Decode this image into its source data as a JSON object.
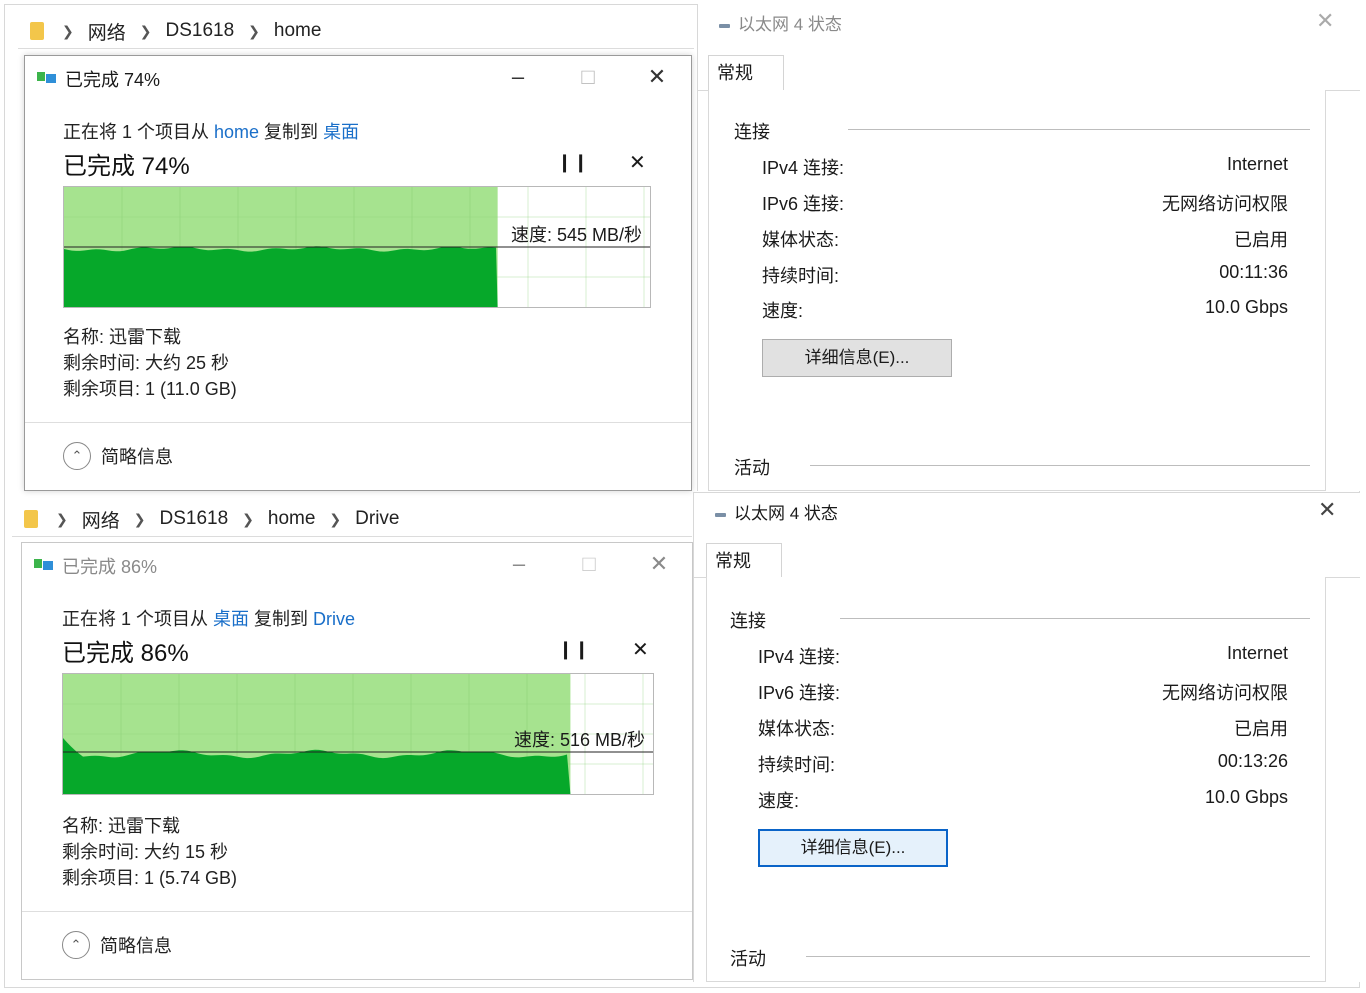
{
  "colors": {
    "link": "#1a6fc9",
    "graph_light": "#a6e38f",
    "graph_dark": "#06a82a",
    "focus": "#0a64c8"
  },
  "top": {
    "explorer": {
      "crumbs": [
        "网络",
        "DS1618",
        "home"
      ]
    },
    "copy": {
      "title": "已完成 74%",
      "from_prefix": "正在将 1 个项目从 ",
      "from": "home",
      "to_mid": " 复制到 ",
      "to": "桌面",
      "percent_text": "已完成 74%",
      "progress": 0.74,
      "speed": "速度: 545 MB/秒",
      "name": "名称: 迅雷下载",
      "remaining_time": "剩余时间: 大约 25 秒",
      "remaining_items": "剩余项目: 1 (11.0 GB)",
      "less_info": "简略信息",
      "minimize_icon": "minimize-icon",
      "maximize_icon": "maximize-icon",
      "close_icon": "close-icon"
    },
    "status": {
      "title": "以太网 4 状态",
      "tab": "常规",
      "group_connection": "连接",
      "rows": [
        {
          "label": "IPv4 连接:",
          "value": "Internet"
        },
        {
          "label": "IPv6 连接:",
          "value": "无网络访问权限"
        },
        {
          "label": "媒体状态:",
          "value": "已启用"
        },
        {
          "label": "持续时间:",
          "value": "00:11:36"
        },
        {
          "label": "速度:",
          "value": "10.0 Gbps"
        }
      ],
      "details_button": "详细信息(E)...",
      "group_activity": "活动"
    }
  },
  "bottom": {
    "explorer": {
      "crumbs": [
        "网络",
        "DS1618",
        "home",
        "Drive"
      ]
    },
    "copy": {
      "title": "已完成 86%",
      "from_prefix": "正在将 1 个项目从 ",
      "from": "桌面",
      "to_mid": " 复制到 ",
      "to": "Drive",
      "percent_text": "已完成 86%",
      "progress": 0.86,
      "speed": "速度: 516 MB/秒",
      "name": "名称: 迅雷下载",
      "remaining_time": "剩余时间: 大约 15 秒",
      "remaining_items": "剩余项目: 1 (5.74 GB)",
      "less_info": "简略信息"
    },
    "status": {
      "title": "以太网 4 状态",
      "tab": "常规",
      "group_connection": "连接",
      "rows": [
        {
          "label": "IPv4 连接:",
          "value": "Internet"
        },
        {
          "label": "IPv6 连接:",
          "value": "无网络访问权限"
        },
        {
          "label": "媒体状态:",
          "value": "已启用"
        },
        {
          "label": "持续时间:",
          "value": "00:13:26"
        },
        {
          "label": "速度:",
          "value": "10.0 Gbps"
        }
      ],
      "details_button": "详细信息(E)...",
      "group_activity": "活动"
    }
  }
}
